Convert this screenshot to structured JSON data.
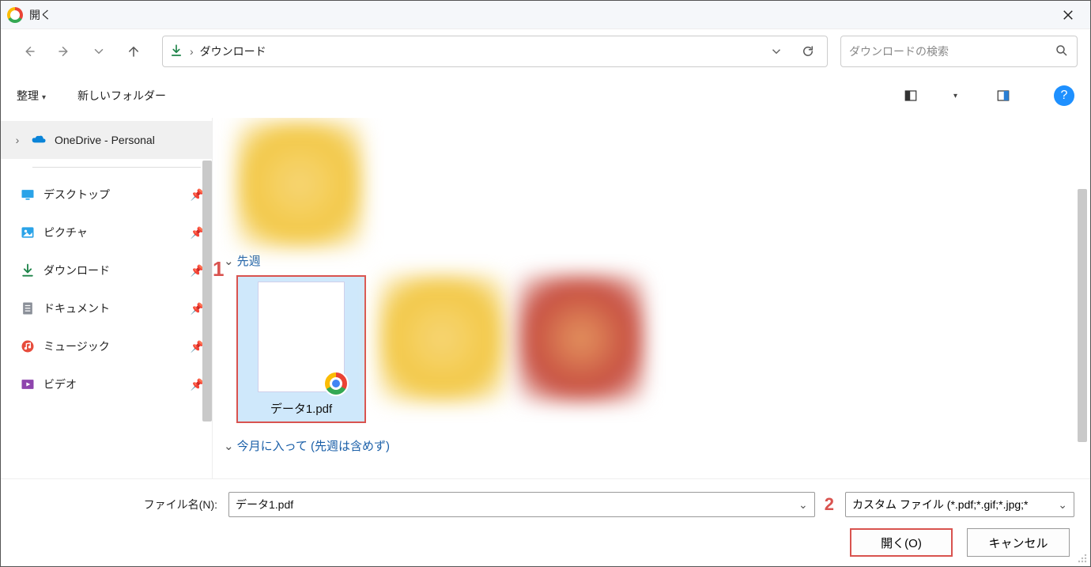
{
  "window": {
    "title": "開く"
  },
  "navbar": {
    "location": "ダウンロード"
  },
  "search": {
    "placeholder": "ダウンロードの検索"
  },
  "toolbar": {
    "organize": "整理",
    "new_folder": "新しいフォルダー"
  },
  "sidebar": {
    "onedrive": "OneDrive - Personal",
    "items": [
      {
        "label": "デスクトップ"
      },
      {
        "label": "ピクチャ"
      },
      {
        "label": "ダウンロード"
      },
      {
        "label": "ドキュメント"
      },
      {
        "label": "ミュージック"
      },
      {
        "label": "ビデオ"
      }
    ]
  },
  "content": {
    "group_last_week": "先週",
    "selected_file": "データ1.pdf",
    "group_this_month": "今月に入って (先週は含めず)"
  },
  "footer": {
    "filename_label": "ファイル名(N):",
    "filename_value": "データ1.pdf",
    "filter_text": "カスタム ファイル (*.pdf;*.gif;*.jpg;*",
    "open_label": "開く(O)",
    "cancel_label": "キャンセル"
  },
  "annotations": {
    "one": "1",
    "two": "2"
  }
}
